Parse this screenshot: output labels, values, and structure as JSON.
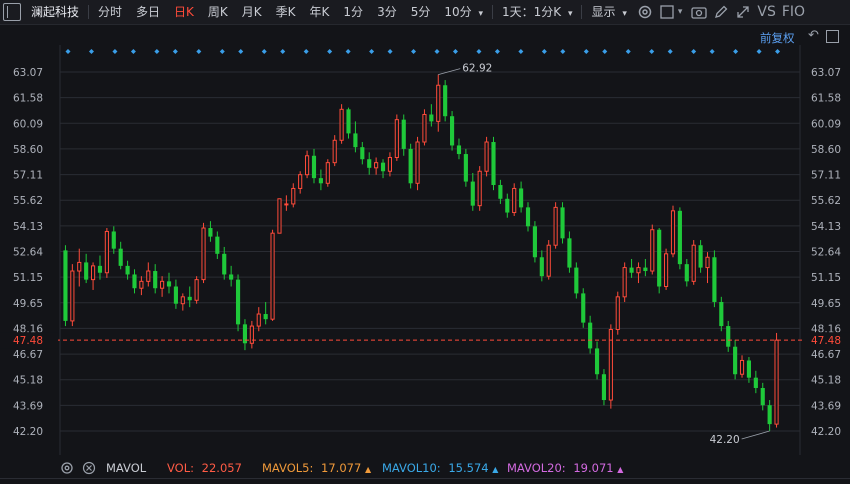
{
  "toolbar": {
    "stock_name": "澜起科技",
    "periods": [
      "分时",
      "多日",
      "日K",
      "周K",
      "月K",
      "季K",
      "年K",
      "1分",
      "3分",
      "5分"
    ],
    "active_period": "日K",
    "more_period": "10分",
    "combo": "1天：1分K",
    "display": "显示",
    "vs": "VS",
    "fio": "FIO",
    "adjust": "前复权"
  },
  "indicator_bar": {
    "name": "MAVOL",
    "vol_label": "VOL:",
    "vol_value": "22.057",
    "mavol5_label": "MAVOL5:",
    "mavol5_value": "17.077",
    "mavol10_label": "MAVOL10:",
    "mavol10_value": "15.574",
    "mavol20_label": "MAVOL20:",
    "mavol20_value": "19.071",
    "colors": {
      "vol": "#ff5b45",
      "mavol5": "#f09a3a",
      "mavol10": "#3aa9e8",
      "mavol20": "#d36ae0"
    }
  },
  "chart_data": {
    "type": "candlestick",
    "y_ticks": [
      "63.07",
      "61.58",
      "60.09",
      "58.60",
      "57.11",
      "55.62",
      "54.13",
      "52.64",
      "51.15",
      "49.65",
      "48.16",
      "46.67",
      "45.18",
      "43.69",
      "42.20"
    ],
    "ylim": [
      42.2,
      63.07
    ],
    "current_price": "47.48",
    "high_label": "62.92",
    "low_label": "42.20",
    "colors": {
      "up": "#ff4b3a",
      "down": "#1fc93a",
      "last_line": "#ff4b3a",
      "marker": "#3a9ee8",
      "grid": "#2a2c33"
    },
    "event_marker_count": 34,
    "candles": [
      [
        52.7,
        53.0,
        48.3,
        48.6
      ],
      [
        48.6,
        51.9,
        48.3,
        51.5
      ],
      [
        51.5,
        52.8,
        50.6,
        52.0
      ],
      [
        52.0,
        52.5,
        50.8,
        51.0
      ],
      [
        51.0,
        52.0,
        50.4,
        51.8
      ],
      [
        51.8,
        52.4,
        51.0,
        51.4
      ],
      [
        51.4,
        54.0,
        51.1,
        53.8
      ],
      [
        53.8,
        54.1,
        52.5,
        52.8
      ],
      [
        52.8,
        53.2,
        51.6,
        51.8
      ],
      [
        51.8,
        52.1,
        51.0,
        51.3
      ],
      [
        51.3,
        51.6,
        50.2,
        50.5
      ],
      [
        50.5,
        51.2,
        50.1,
        50.9
      ],
      [
        50.9,
        52.0,
        50.6,
        51.5
      ],
      [
        51.5,
        51.9,
        50.2,
        50.5
      ],
      [
        50.5,
        51.2,
        50.0,
        50.9
      ],
      [
        50.9,
        51.4,
        50.2,
        50.6
      ],
      [
        50.6,
        51.0,
        49.3,
        49.6
      ],
      [
        49.6,
        50.2,
        49.2,
        50.0
      ],
      [
        50.0,
        50.6,
        49.4,
        49.8
      ],
      [
        49.8,
        51.2,
        49.6,
        51.0
      ],
      [
        51.0,
        54.3,
        50.8,
        54.0
      ],
      [
        54.0,
        54.4,
        53.2,
        53.5
      ],
      [
        53.5,
        53.8,
        52.2,
        52.5
      ],
      [
        52.5,
        52.9,
        51.0,
        51.3
      ],
      [
        51.3,
        51.8,
        50.6,
        51.0
      ],
      [
        51.0,
        51.3,
        48.0,
        48.4
      ],
      [
        48.4,
        48.7,
        46.9,
        47.3
      ],
      [
        47.3,
        48.6,
        47.0,
        48.3
      ],
      [
        48.3,
        49.4,
        48.0,
        49.0
      ],
      [
        49.0,
        49.7,
        48.4,
        48.7
      ],
      [
        48.7,
        53.9,
        48.6,
        53.7
      ],
      [
        53.7,
        54.2,
        55.4,
        55.7
      ],
      [
        55.4,
        55.9,
        55.0,
        55.4
      ],
      [
        55.4,
        56.6,
        55.2,
        56.3
      ],
      [
        56.3,
        57.3,
        56.0,
        57.1
      ],
      [
        57.1,
        58.5,
        56.9,
        58.2
      ],
      [
        58.2,
        58.6,
        56.6,
        56.9
      ],
      [
        56.9,
        57.4,
        56.2,
        56.6
      ],
      [
        56.6,
        58.0,
        56.4,
        57.8
      ],
      [
        57.8,
        59.4,
        57.6,
        59.1
      ],
      [
        59.1,
        61.2,
        58.9,
        60.9
      ],
      [
        60.9,
        61.0,
        59.2,
        59.5
      ],
      [
        59.5,
        60.2,
        58.4,
        58.7
      ],
      [
        58.7,
        59.0,
        57.7,
        58.0
      ],
      [
        58.0,
        58.4,
        57.1,
        57.5
      ],
      [
        57.5,
        58.1,
        57.1,
        57.8
      ],
      [
        57.8,
        58.0,
        56.9,
        57.3
      ],
      [
        57.3,
        58.4,
        57.0,
        58.1
      ],
      [
        58.1,
        60.6,
        57.9,
        60.3
      ],
      [
        60.3,
        60.6,
        58.2,
        58.6
      ],
      [
        58.6,
        58.9,
        56.3,
        56.6
      ],
      [
        56.6,
        59.3,
        56.2,
        59.0
      ],
      [
        59.0,
        60.9,
        58.8,
        60.6
      ],
      [
        60.6,
        61.2,
        59.9,
        60.2
      ],
      [
        60.2,
        62.92,
        59.6,
        62.3
      ],
      [
        62.3,
        62.6,
        60.2,
        60.5
      ],
      [
        60.5,
        60.8,
        58.5,
        58.8
      ],
      [
        58.8,
        59.2,
        58.0,
        58.3
      ],
      [
        58.3,
        58.6,
        56.4,
        56.7
      ],
      [
        56.7,
        57.2,
        55.0,
        55.3
      ],
      [
        55.3,
        57.6,
        55.0,
        57.3
      ],
      [
        57.3,
        59.3,
        57.0,
        59.0
      ],
      [
        59.0,
        59.3,
        56.2,
        56.5
      ],
      [
        56.5,
        56.8,
        55.4,
        55.7
      ],
      [
        55.7,
        56.0,
        54.6,
        54.9
      ],
      [
        54.9,
        56.6,
        54.7,
        56.3
      ],
      [
        56.3,
        56.7,
        54.9,
        55.2
      ],
      [
        55.2,
        55.5,
        53.8,
        54.1
      ],
      [
        54.1,
        54.4,
        52.0,
        52.3
      ],
      [
        52.3,
        52.7,
        50.9,
        51.2
      ],
      [
        51.2,
        53.3,
        51.0,
        53.0
      ],
      [
        53.0,
        55.5,
        52.8,
        55.2
      ],
      [
        55.2,
        55.5,
        53.1,
        53.4
      ],
      [
        53.4,
        53.8,
        51.4,
        51.7
      ],
      [
        51.7,
        52.0,
        49.9,
        50.2
      ],
      [
        50.2,
        50.5,
        48.2,
        48.5
      ],
      [
        48.5,
        48.9,
        46.7,
        47.0
      ],
      [
        47.0,
        47.4,
        45.2,
        45.5
      ],
      [
        45.5,
        45.8,
        43.7,
        44.0
      ],
      [
        44.0,
        48.4,
        43.5,
        48.1
      ],
      [
        48.1,
        50.3,
        47.8,
        50.0
      ],
      [
        50.0,
        52.0,
        49.7,
        51.7
      ],
      [
        51.7,
        52.2,
        51.1,
        51.4
      ],
      [
        51.4,
        52.0,
        50.8,
        51.7
      ],
      [
        51.7,
        52.2,
        51.2,
        51.5
      ],
      [
        51.5,
        54.2,
        51.3,
        53.9
      ],
      [
        53.9,
        54.0,
        50.2,
        50.6
      ],
      [
        50.6,
        52.8,
        50.4,
        52.5
      ],
      [
        52.5,
        55.3,
        52.3,
        55.0
      ],
      [
        55.0,
        55.2,
        51.6,
        51.9
      ],
      [
        51.9,
        52.2,
        50.6,
        50.9
      ],
      [
        50.9,
        53.3,
        50.7,
        53.0
      ],
      [
        53.0,
        53.3,
        51.4,
        51.7
      ],
      [
        51.7,
        52.6,
        50.8,
        52.3
      ],
      [
        52.3,
        52.7,
        49.4,
        49.7
      ],
      [
        49.7,
        50.0,
        48.0,
        48.3
      ],
      [
        48.3,
        48.6,
        46.8,
        47.1
      ],
      [
        47.1,
        47.5,
        45.2,
        45.5
      ],
      [
        45.5,
        46.6,
        45.3,
        46.3
      ],
      [
        46.3,
        46.5,
        45.0,
        45.3
      ],
      [
        45.3,
        45.7,
        44.4,
        44.7
      ],
      [
        44.7,
        45.0,
        43.4,
        43.7
      ],
      [
        43.7,
        44.0,
        42.2,
        42.6
      ],
      [
        42.6,
        47.9,
        42.4,
        47.48
      ]
    ]
  }
}
